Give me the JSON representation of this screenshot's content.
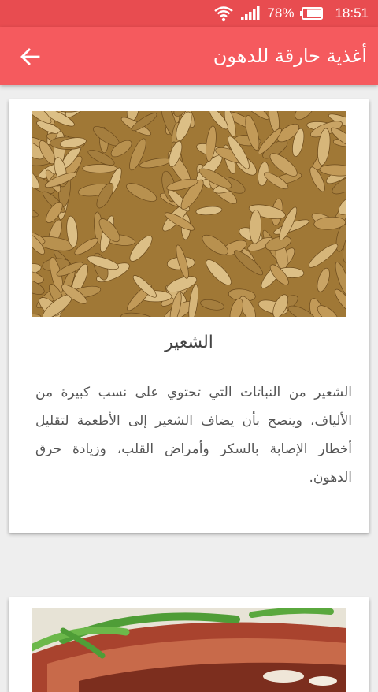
{
  "status_bar": {
    "battery": "78%",
    "time": "18:51",
    "icons": [
      "wifi-icon",
      "signal-icon",
      "battery-icon"
    ]
  },
  "app_bar": {
    "title": "أغذية حارقة للدهون",
    "back_icon": "arrow-back-icon"
  },
  "cards": [
    {
      "title": "الشعير",
      "description": "الشعير من النباتات التي تحتوي على نسب كبيرة من الألياف، وينصح بأن يضاف الشعير إلى الأطعمة لتقليل أخطار الإصابة بالسكر وأمراض القلب، وزيادة حرق الدهون."
    }
  ],
  "colors": {
    "status_bar": "#e84c50",
    "app_bar": "#f55a5e",
    "background": "#eeeeee"
  }
}
